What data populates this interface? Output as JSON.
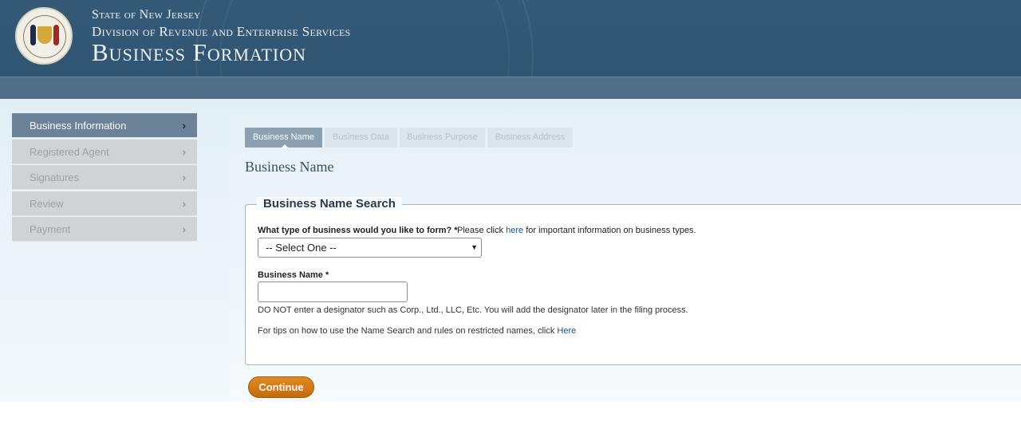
{
  "header": {
    "line1": "State of New Jersey",
    "line2": "Division of Revenue and Enterprise Services",
    "title": "Business Formation",
    "seal_icon": "nj-state-seal-icon"
  },
  "sidebar": {
    "items": [
      {
        "label": "Business Information",
        "active": true
      },
      {
        "label": "Registered Agent",
        "active": false
      },
      {
        "label": "Signatures",
        "active": false
      },
      {
        "label": "Review",
        "active": false
      },
      {
        "label": "Payment",
        "active": false
      }
    ],
    "chevron": "›"
  },
  "tabs": [
    {
      "label": "Business Name",
      "active": true
    },
    {
      "label": "Business Data",
      "active": false
    },
    {
      "label": "Business Purpose",
      "active": false
    },
    {
      "label": "Business Address",
      "active": false
    }
  ],
  "main": {
    "section_title": "Business Name",
    "fieldset": {
      "legend": "Business Name Search",
      "type_question": "What type of business would you like to form? *",
      "type_info_prefix": "Please click",
      "type_info_link": "here",
      "type_info_suffix": "for important information on business types.",
      "select_value": "-- Select One --",
      "name_label": "Business Name *",
      "name_value": "",
      "designator_note": "DO NOT enter a designator such as Corp., Ltd., LLC, Etc. You will add the designator later in the filing process.",
      "tips_prefix": "For tips on how to use the Name Search and rules on restricted names, click",
      "tips_link": "Here"
    },
    "continue_label": "Continue"
  },
  "colors": {
    "header_bg": "#345a78",
    "nav_bg": "#4f6e86",
    "active_side": "#6b8298",
    "button": "#d07a17",
    "link": "#1c4f8a"
  }
}
